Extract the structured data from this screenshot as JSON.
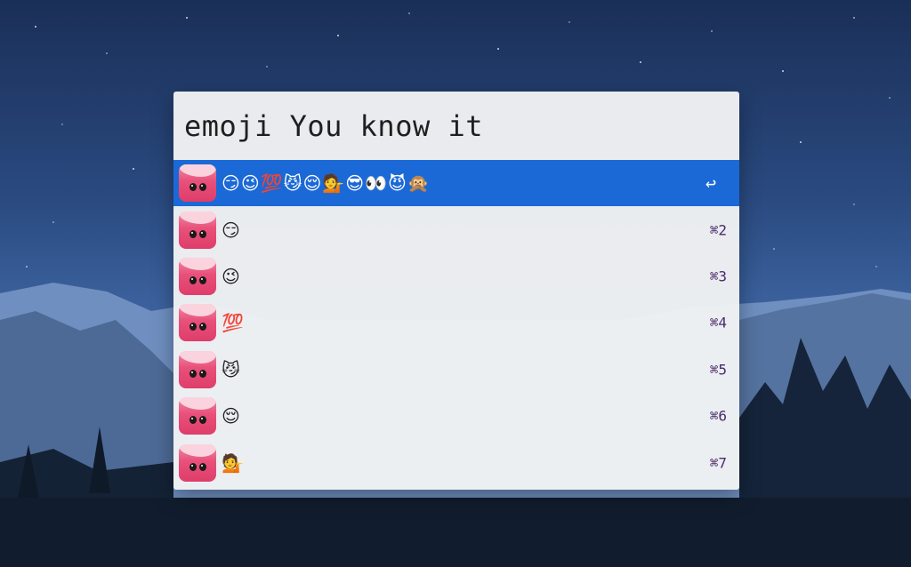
{
  "query": "emoji You know it",
  "results": [
    {
      "emoji": "😏😉💯😼😌💁😎👀😈🙊",
      "shortcut": "↩",
      "selected": true
    },
    {
      "emoji": "😏",
      "shortcut": "⌘2",
      "selected": false
    },
    {
      "emoji": "😉",
      "shortcut": "⌘3",
      "selected": false
    },
    {
      "emoji": "💯",
      "shortcut": "⌘4",
      "selected": false
    },
    {
      "emoji": "😼",
      "shortcut": "⌘5",
      "selected": false
    },
    {
      "emoji": "😌",
      "shortcut": "⌘6",
      "selected": false
    },
    {
      "emoji": "💁",
      "shortcut": "⌘7",
      "selected": false
    }
  ],
  "icons": {
    "app_icon": "emoji-app-icon",
    "accent_color": "#1b69d6"
  }
}
